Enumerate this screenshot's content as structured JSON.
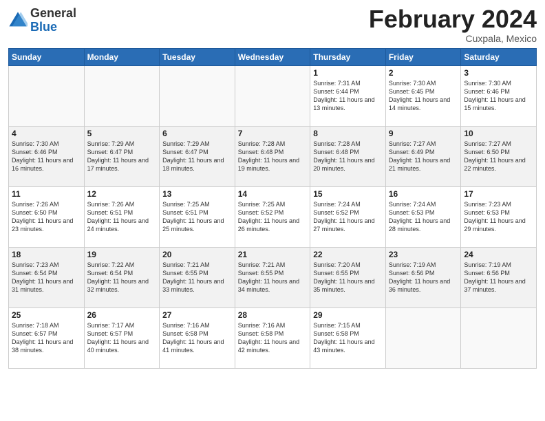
{
  "header": {
    "logo_general": "General",
    "logo_blue": "Blue",
    "month_title": "February 2024",
    "subtitle": "Cuxpala, Mexico"
  },
  "days_of_week": [
    "Sunday",
    "Monday",
    "Tuesday",
    "Wednesday",
    "Thursday",
    "Friday",
    "Saturday"
  ],
  "weeks": [
    [
      {
        "day": "",
        "sunrise": "",
        "sunset": "",
        "daylight": ""
      },
      {
        "day": "",
        "sunrise": "",
        "sunset": "",
        "daylight": ""
      },
      {
        "day": "",
        "sunrise": "",
        "sunset": "",
        "daylight": ""
      },
      {
        "day": "",
        "sunrise": "",
        "sunset": "",
        "daylight": ""
      },
      {
        "day": "1",
        "sunrise": "7:31 AM",
        "sunset": "6:44 PM",
        "daylight": "11 hours and 13 minutes."
      },
      {
        "day": "2",
        "sunrise": "7:30 AM",
        "sunset": "6:45 PM",
        "daylight": "11 hours and 14 minutes."
      },
      {
        "day": "3",
        "sunrise": "7:30 AM",
        "sunset": "6:46 PM",
        "daylight": "11 hours and 15 minutes."
      }
    ],
    [
      {
        "day": "4",
        "sunrise": "7:30 AM",
        "sunset": "6:46 PM",
        "daylight": "11 hours and 16 minutes."
      },
      {
        "day": "5",
        "sunrise": "7:29 AM",
        "sunset": "6:47 PM",
        "daylight": "11 hours and 17 minutes."
      },
      {
        "day": "6",
        "sunrise": "7:29 AM",
        "sunset": "6:47 PM",
        "daylight": "11 hours and 18 minutes."
      },
      {
        "day": "7",
        "sunrise": "7:28 AM",
        "sunset": "6:48 PM",
        "daylight": "11 hours and 19 minutes."
      },
      {
        "day": "8",
        "sunrise": "7:28 AM",
        "sunset": "6:48 PM",
        "daylight": "11 hours and 20 minutes."
      },
      {
        "day": "9",
        "sunrise": "7:27 AM",
        "sunset": "6:49 PM",
        "daylight": "11 hours and 21 minutes."
      },
      {
        "day": "10",
        "sunrise": "7:27 AM",
        "sunset": "6:50 PM",
        "daylight": "11 hours and 22 minutes."
      }
    ],
    [
      {
        "day": "11",
        "sunrise": "7:26 AM",
        "sunset": "6:50 PM",
        "daylight": "11 hours and 23 minutes."
      },
      {
        "day": "12",
        "sunrise": "7:26 AM",
        "sunset": "6:51 PM",
        "daylight": "11 hours and 24 minutes."
      },
      {
        "day": "13",
        "sunrise": "7:25 AM",
        "sunset": "6:51 PM",
        "daylight": "11 hours and 25 minutes."
      },
      {
        "day": "14",
        "sunrise": "7:25 AM",
        "sunset": "6:52 PM",
        "daylight": "11 hours and 26 minutes."
      },
      {
        "day": "15",
        "sunrise": "7:24 AM",
        "sunset": "6:52 PM",
        "daylight": "11 hours and 27 minutes."
      },
      {
        "day": "16",
        "sunrise": "7:24 AM",
        "sunset": "6:53 PM",
        "daylight": "11 hours and 28 minutes."
      },
      {
        "day": "17",
        "sunrise": "7:23 AM",
        "sunset": "6:53 PM",
        "daylight": "11 hours and 29 minutes."
      }
    ],
    [
      {
        "day": "18",
        "sunrise": "7:23 AM",
        "sunset": "6:54 PM",
        "daylight": "11 hours and 31 minutes."
      },
      {
        "day": "19",
        "sunrise": "7:22 AM",
        "sunset": "6:54 PM",
        "daylight": "11 hours and 32 minutes."
      },
      {
        "day": "20",
        "sunrise": "7:21 AM",
        "sunset": "6:55 PM",
        "daylight": "11 hours and 33 minutes."
      },
      {
        "day": "21",
        "sunrise": "7:21 AM",
        "sunset": "6:55 PM",
        "daylight": "11 hours and 34 minutes."
      },
      {
        "day": "22",
        "sunrise": "7:20 AM",
        "sunset": "6:55 PM",
        "daylight": "11 hours and 35 minutes."
      },
      {
        "day": "23",
        "sunrise": "7:19 AM",
        "sunset": "6:56 PM",
        "daylight": "11 hours and 36 minutes."
      },
      {
        "day": "24",
        "sunrise": "7:19 AM",
        "sunset": "6:56 PM",
        "daylight": "11 hours and 37 minutes."
      }
    ],
    [
      {
        "day": "25",
        "sunrise": "7:18 AM",
        "sunset": "6:57 PM",
        "daylight": "11 hours and 38 minutes."
      },
      {
        "day": "26",
        "sunrise": "7:17 AM",
        "sunset": "6:57 PM",
        "daylight": "11 hours and 40 minutes."
      },
      {
        "day": "27",
        "sunrise": "7:16 AM",
        "sunset": "6:58 PM",
        "daylight": "11 hours and 41 minutes."
      },
      {
        "day": "28",
        "sunrise": "7:16 AM",
        "sunset": "6:58 PM",
        "daylight": "11 hours and 42 minutes."
      },
      {
        "day": "29",
        "sunrise": "7:15 AM",
        "sunset": "6:58 PM",
        "daylight": "11 hours and 43 minutes."
      },
      {
        "day": "",
        "sunrise": "",
        "sunset": "",
        "daylight": ""
      },
      {
        "day": "",
        "sunrise": "",
        "sunset": "",
        "daylight": ""
      }
    ]
  ]
}
